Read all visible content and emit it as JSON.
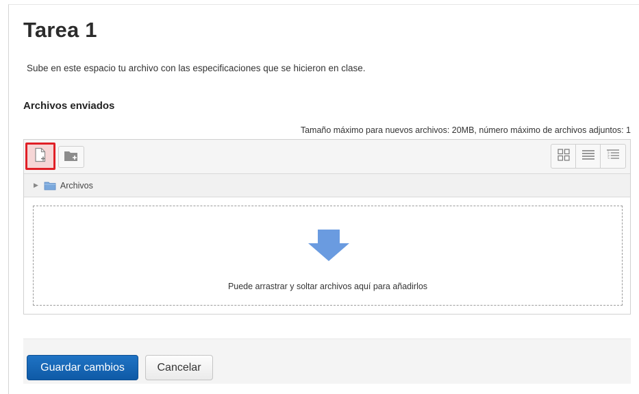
{
  "page": {
    "title": "Tarea 1",
    "intro": "Sube en este espacio tu archivo con las especificaciones que se hicieron en clase.",
    "section_title": "Archivos enviados",
    "limits_text": "Tamaño máximo para nuevos archivos: 20MB, número máximo de archivos adjuntos: 1"
  },
  "filemanager": {
    "toolbar": {
      "add_file_icon": "add-file-icon",
      "create_folder_icon": "create-folder-icon",
      "views": [
        "view-icons-icon",
        "view-details-icon",
        "view-tree-icon"
      ]
    },
    "path": {
      "folder_label": "Archivos"
    },
    "dropzone": {
      "message": "Puede arrastrar y soltar archivos aquí para añadirlos",
      "arrow_color": "#6a9be0"
    },
    "highlight_color": "#e01f26"
  },
  "footer": {
    "save_label": "Guardar cambios",
    "cancel_label": "Cancelar"
  }
}
